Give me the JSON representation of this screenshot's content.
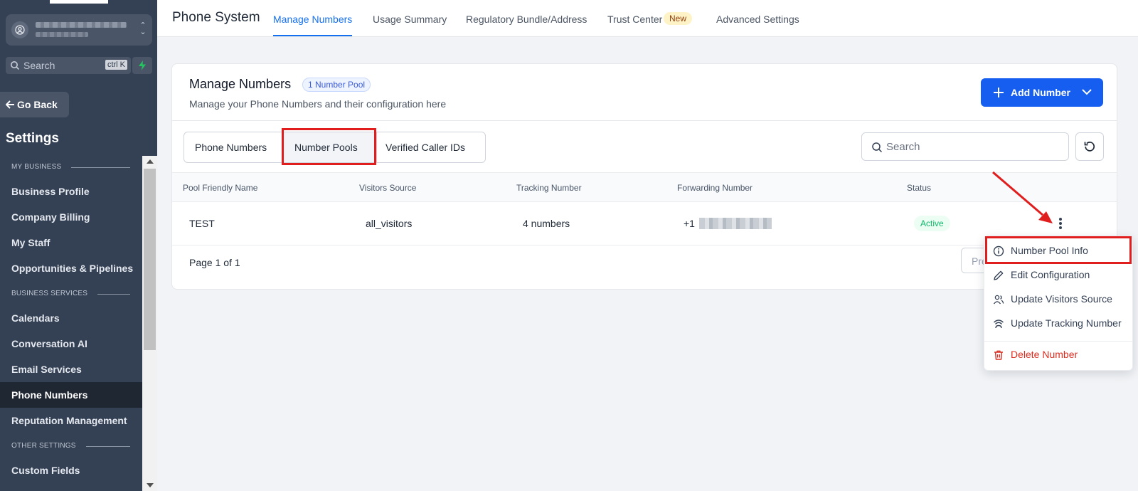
{
  "sidebar": {
    "search_placeholder": "Search",
    "search_shortcut": "ctrl K",
    "go_back": "Go Back",
    "settings_title": "Settings",
    "nav": [
      {
        "type": "section",
        "label": "MY BUSINESS"
      },
      {
        "type": "item",
        "label": "Business Profile"
      },
      {
        "type": "item",
        "label": "Company Billing"
      },
      {
        "type": "item",
        "label": "My Staff"
      },
      {
        "type": "item",
        "label": "Opportunities & Pipelines"
      },
      {
        "type": "section",
        "label": "BUSINESS SERVICES"
      },
      {
        "type": "item",
        "label": "Calendars"
      },
      {
        "type": "item",
        "label": "Conversation AI"
      },
      {
        "type": "item",
        "label": "Email Services"
      },
      {
        "type": "item",
        "label": "Phone Numbers",
        "active": true
      },
      {
        "type": "item",
        "label": "Reputation Management"
      },
      {
        "type": "section",
        "label": "OTHER SETTINGS"
      },
      {
        "type": "item",
        "label": "Custom Fields"
      }
    ]
  },
  "header": {
    "title": "Phone System",
    "tabs": [
      {
        "label": "Manage Numbers",
        "active": true
      },
      {
        "label": "Usage Summary"
      },
      {
        "label": "Regulatory Bundle/Address"
      },
      {
        "label": "Trust Center",
        "badge": "New"
      },
      {
        "label": "Advanced Settings"
      }
    ]
  },
  "card": {
    "title": "Manage Numbers",
    "pool_badge": "1 Number Pool",
    "subtitle": "Manage your Phone Numbers and their configuration here",
    "add_button": "Add Number",
    "segments": [
      "Phone Numbers",
      "Number Pools",
      "Verified Caller IDs"
    ],
    "search_placeholder": "Search",
    "columns": [
      "Pool Friendly Name",
      "Visitors Source",
      "Tracking Number",
      "Forwarding Number",
      "Status"
    ],
    "rows": [
      {
        "name": "TEST",
        "source": "all_visitors",
        "tracking": "4 numbers",
        "forwarding_prefix": "+1",
        "status": "Active"
      }
    ],
    "pagination": "Page 1 of 1",
    "prev_button": "Pre"
  },
  "menu": {
    "items": [
      "Number Pool Info",
      "Edit Configuration",
      "Update Visitors Source",
      "Update Tracking Number"
    ],
    "danger_item": "Delete Number"
  },
  "colors": {
    "sidebar_bg": "#344054",
    "accent": "#155eef",
    "status_green": "#12b76a",
    "danger": "#d92d20",
    "annotation_red": "#e01e1e"
  }
}
